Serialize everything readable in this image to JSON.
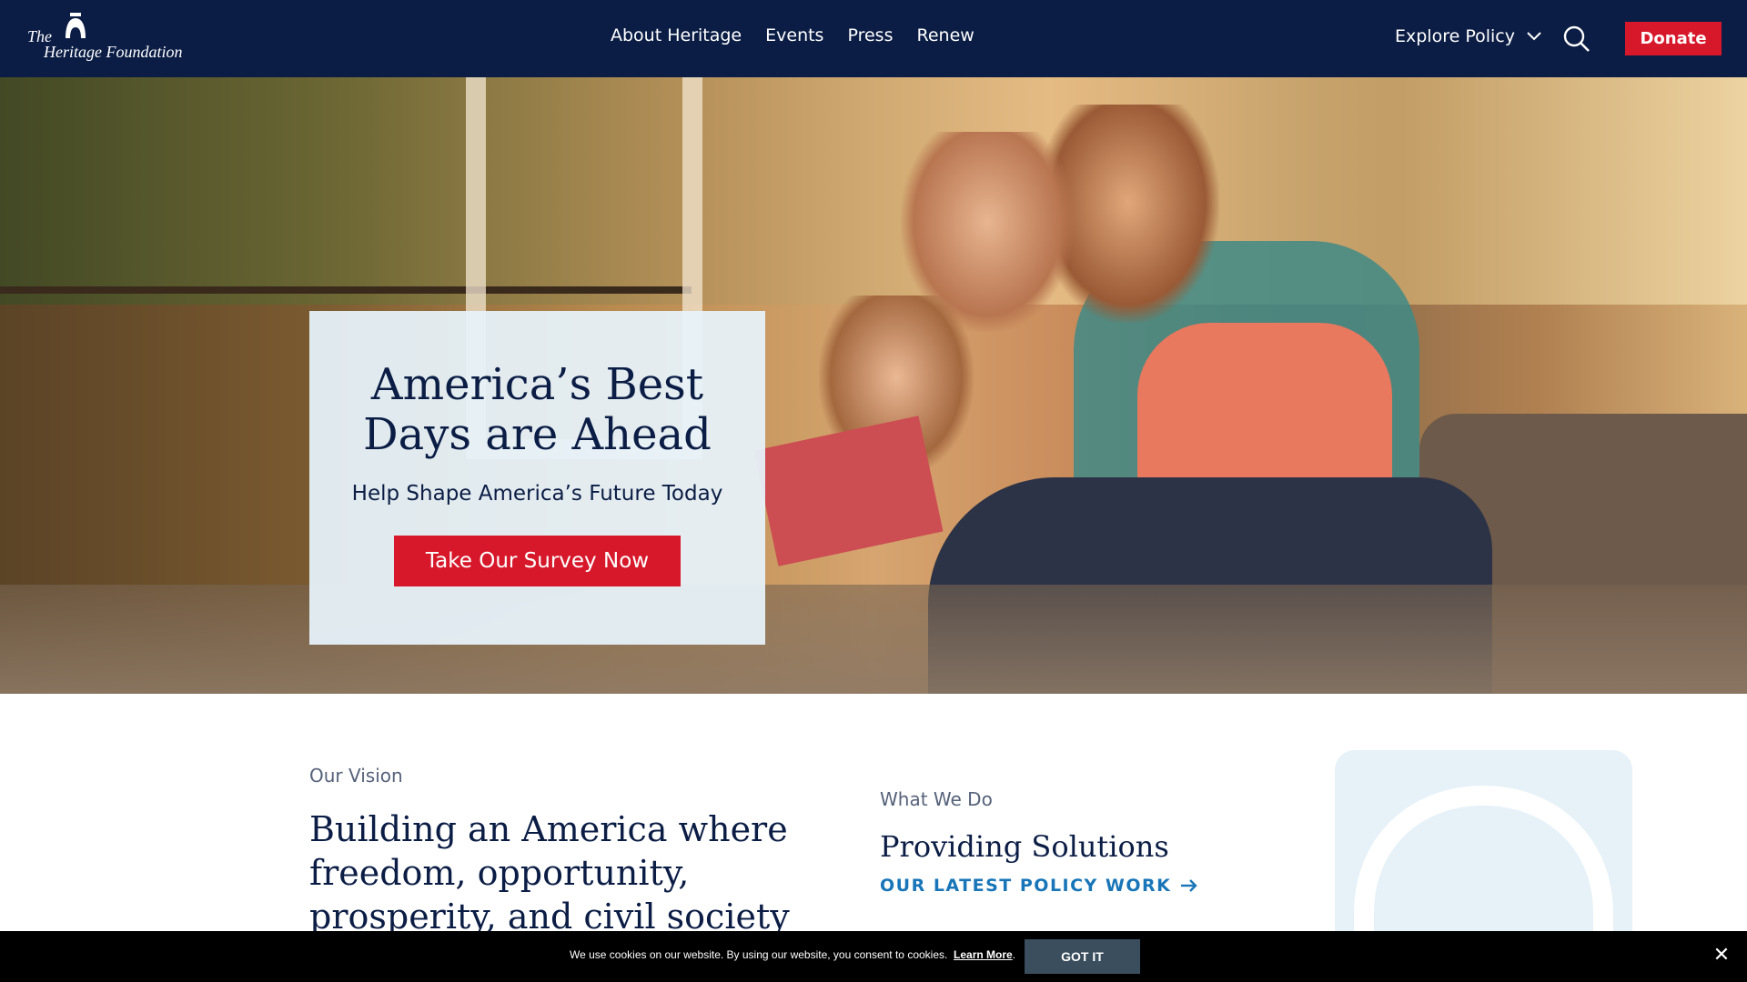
{
  "header": {
    "logo_line1": "The",
    "logo_line2": "Heritage Foundation",
    "nav": [
      "About Heritage",
      "Events",
      "Press",
      "Renew"
    ],
    "explore_label": "Explore Policy",
    "donate_label": "Donate"
  },
  "hero": {
    "title_line1": "America’s Best",
    "title_line2": "Days are Ahead",
    "subtitle": "Help Shape America’s Future Today",
    "cta_label": "Take Our Survey Now"
  },
  "vision": {
    "label": "Our Vision",
    "text": "Building an America where freedom, opportunity, prosperity, and civil society flourish."
  },
  "what_we_do": {
    "label": "What We Do",
    "heading": "Providing Solutions",
    "link": "OUR LATEST POLICY WORK"
  },
  "cookie": {
    "message": "We use cookies on our website. By using our website, you consent to cookies.",
    "learn_more": "Learn More",
    "period": ".",
    "accept_label": "GOT IT",
    "close_symbol": "✕"
  },
  "colors": {
    "navy": "#0b1d45",
    "red": "#d7182a",
    "link_blue": "#1876b8",
    "card_bg": "#e7f2fa"
  }
}
